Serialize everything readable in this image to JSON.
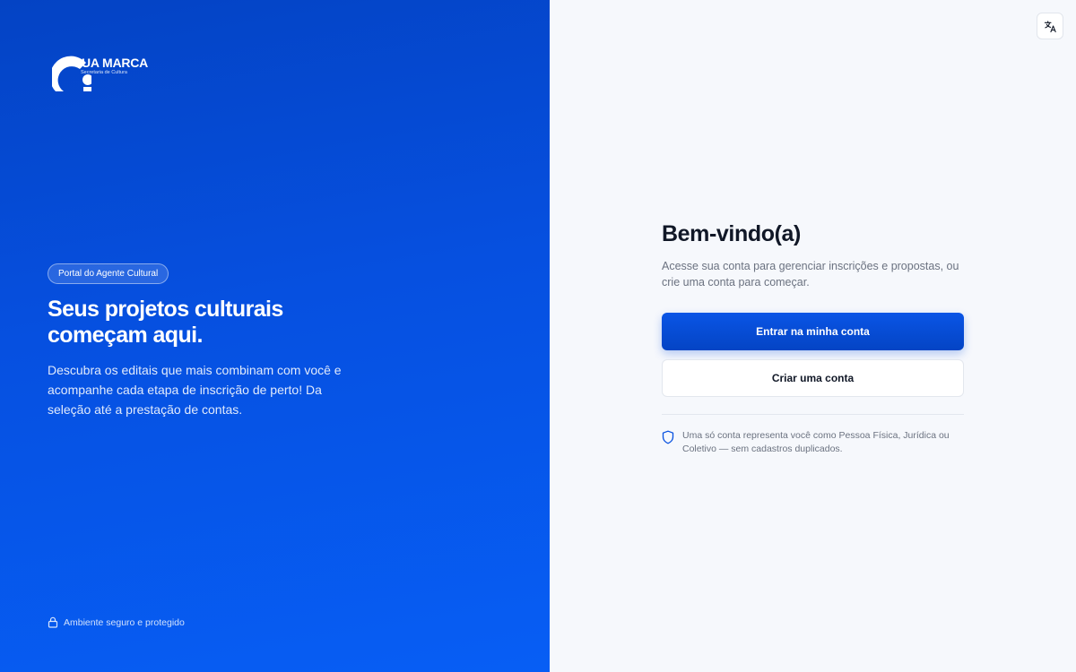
{
  "brand": {
    "name": "UA MARCA",
    "subtitle": "Secretaria de Cultura"
  },
  "hero": {
    "badge": "Portal do Agente Cultural",
    "title": "Seus projetos culturais começam aqui.",
    "description": "Descubra os editais que mais combinam com você e acompanhe cada etapa de inscrição de perto! Da seleção até a prestação de contas.",
    "secure_label": "Ambiente seguro e protegido"
  },
  "panel": {
    "language_icon": "translate-icon",
    "title": "Bem-vindo(a)",
    "subtitle": "Acesse sua conta para gerenciar inscrições e propostas, ou crie uma conta para começar.",
    "login_label": "Entrar na minha conta",
    "signup_label": "Criar uma conta",
    "note": "Uma só conta representa você como Pessoa Física, Jurídica ou Coletivo — sem cadastros duplicados."
  },
  "colors": {
    "accent": "#0650E0",
    "hero_top": "#0443C4",
    "hero_bottom": "#075EF5",
    "panel_bg": "#F6F8FC"
  }
}
